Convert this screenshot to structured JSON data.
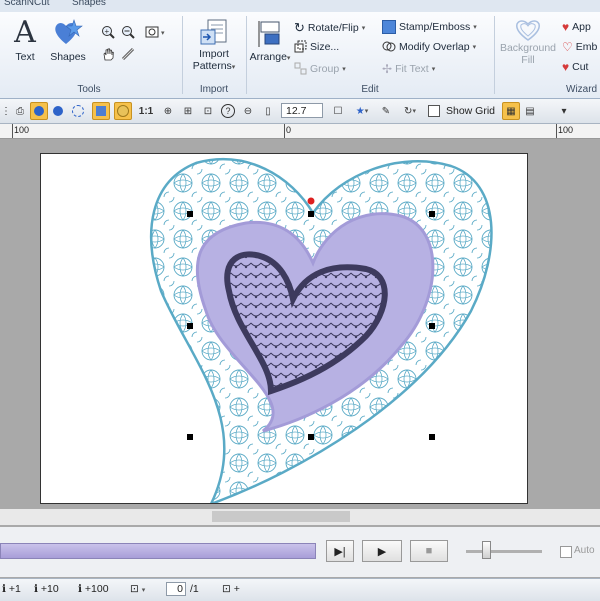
{
  "ribbon_tabs": [
    "ScanNCut",
    "Shapes"
  ],
  "groups": {
    "tools": "Tools",
    "import": "Import",
    "edit": "Edit",
    "wizard": "Wizard"
  },
  "buttons": {
    "text": "Text",
    "shapes": "Shapes",
    "import_patterns": [
      "Import",
      "Patterns"
    ],
    "arrange": "Arrange",
    "rotate_flip": "Rotate/Flip",
    "size": "Size...",
    "group": "Group",
    "stamp_emboss": "Stamp/Emboss",
    "modify_overlap": "Modify Overlap",
    "fit_text": "Fit Text",
    "background_fill": [
      "Background",
      "Fill"
    ],
    "applique": "App",
    "emboss": "Emb",
    "cutwork": "Cut"
  },
  "toolbar": {
    "ratio": "1:1",
    "zoom_value": "12.7",
    "show_grid": "Show Grid"
  },
  "ruler": [
    "100",
    "0",
    "100"
  ],
  "playback": {
    "auto_label": "Auto"
  },
  "bottom": {
    "step_plus1": "+1",
    "step_plus10": "+10",
    "step_plus100": "+100",
    "page_current": "0",
    "page_total": "/1",
    "add": "+"
  },
  "colors": {
    "outline_thread": "#5aaac6",
    "fill_thread": "#b7b1e3",
    "inner_thread": "#3d3a5e",
    "selection_handle": "#000000",
    "rotate_handle": "#dd1f1f"
  }
}
